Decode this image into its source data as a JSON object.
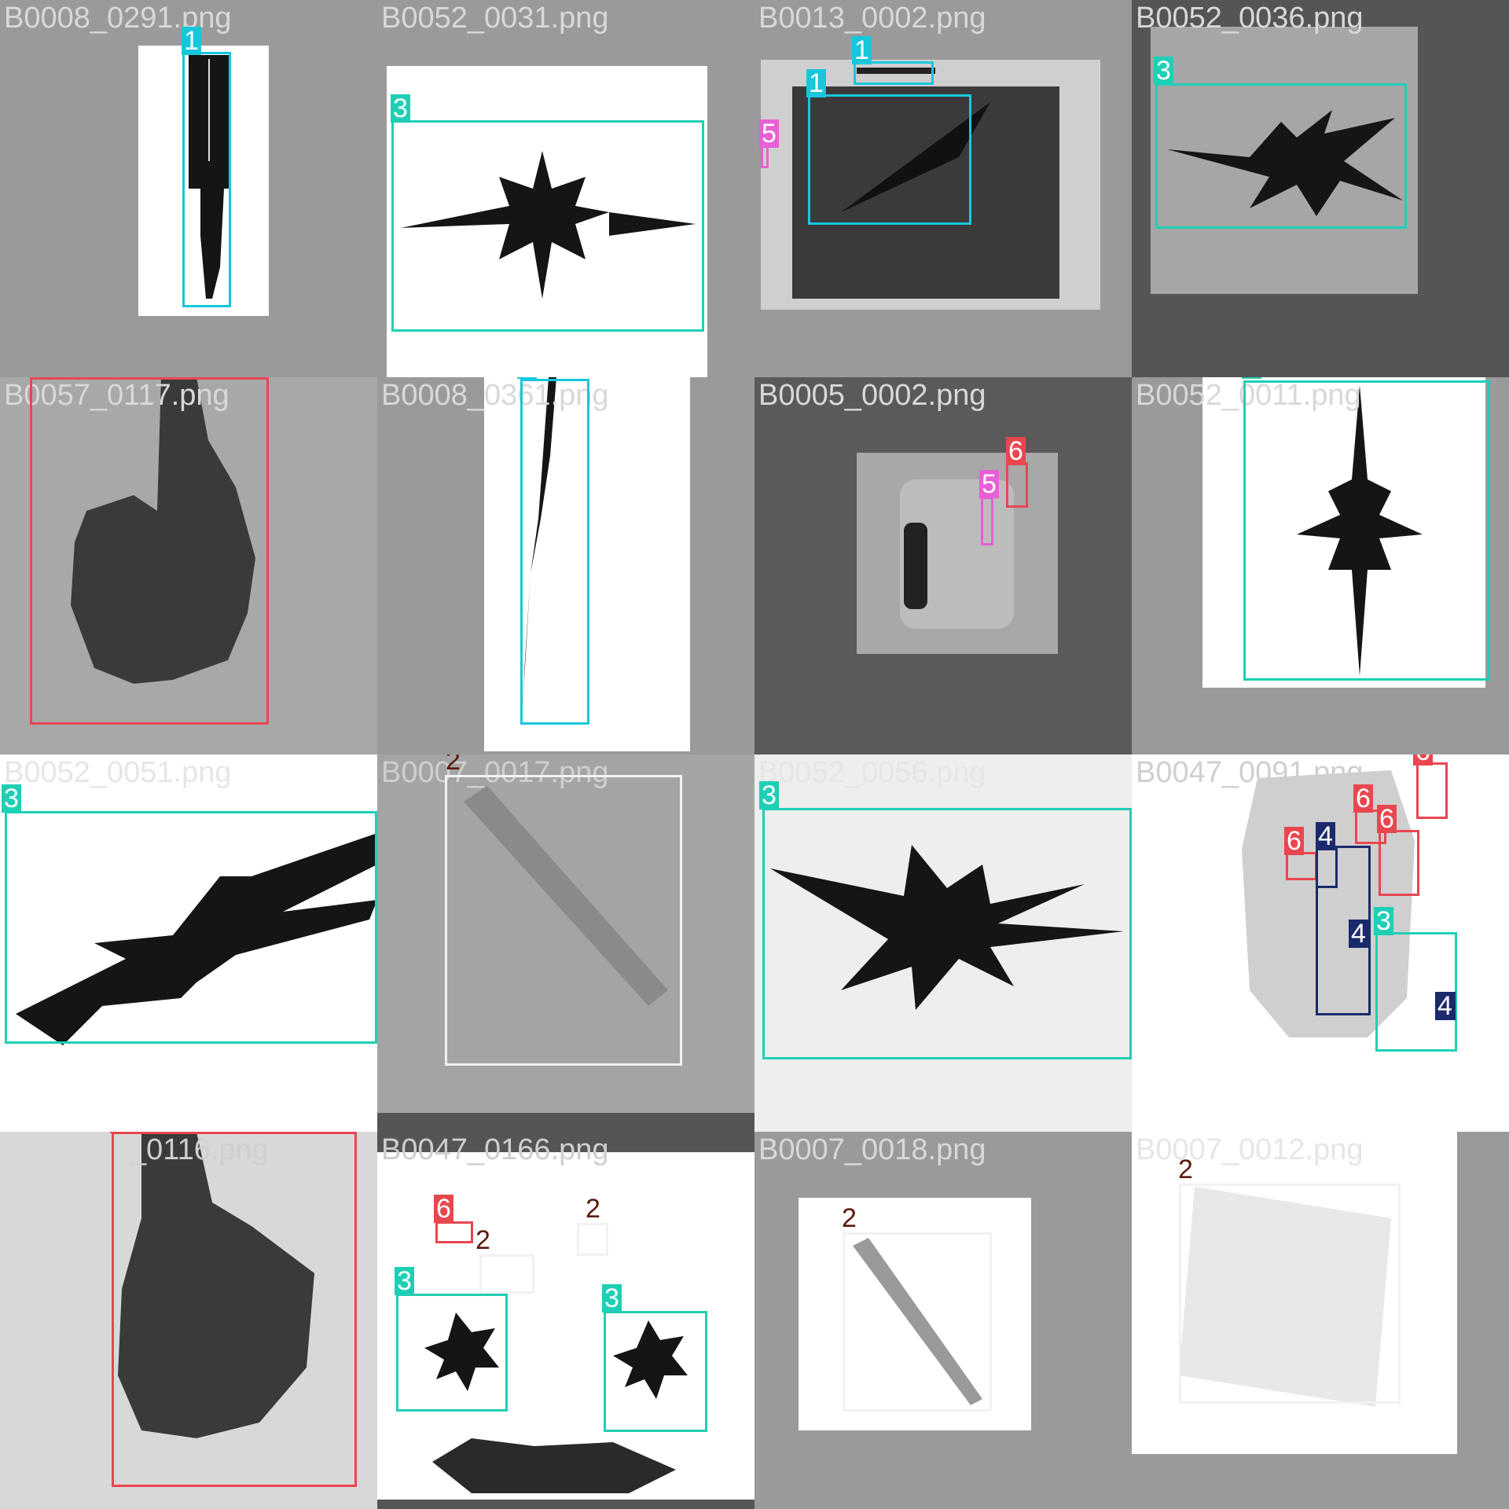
{
  "classes": {
    "1": {
      "color": "#16c7dc"
    },
    "2": {
      "color": "#f2f2f2",
      "label_color": "#5a1a0a"
    },
    "3": {
      "color": "#1fcfb5"
    },
    "4": {
      "color": "#1a2a6b"
    },
    "5": {
      "color": "#e85fd6"
    },
    "6": {
      "color": "#e84750"
    }
  },
  "tiles": [
    {
      "filename": "B0008_0291.png",
      "labels": [
        "1"
      ]
    },
    {
      "filename": "B0052_0031.png",
      "labels": [
        "3"
      ]
    },
    {
      "filename": "B0013_0002.png",
      "labels": [
        "1",
        "1",
        "5"
      ]
    },
    {
      "filename": "B0052_0036.png",
      "labels": [
        "3"
      ]
    },
    {
      "filename": "B0057_0117.png",
      "labels": [
        "6"
      ]
    },
    {
      "filename": "B0008_0361.png",
      "labels": [
        "1"
      ]
    },
    {
      "filename": "B0005_0002.png",
      "labels": [
        "6",
        "5"
      ]
    },
    {
      "filename": "B0052_0011.png",
      "labels": [
        "3"
      ]
    },
    {
      "filename": "B0052_0051.png",
      "labels": [
        "3"
      ]
    },
    {
      "filename": "B0007_0017.png",
      "labels": [
        "2"
      ]
    },
    {
      "filename": "B0052_0056.png",
      "labels": [
        "3"
      ]
    },
    {
      "filename": "B0047_0091.png",
      "labels": [
        "6",
        "6",
        "6",
        "6",
        "4",
        "4",
        "4",
        "3",
        "4"
      ]
    },
    {
      "filename": "_0116.png",
      "labels": [
        "6"
      ]
    },
    {
      "filename": "B0047_0166.png",
      "labels": [
        "6",
        "2",
        "2",
        "3",
        "3"
      ]
    },
    {
      "filename": "B0007_0018.png",
      "labels": [
        "2"
      ]
    },
    {
      "filename": "B0007_0012.png",
      "labels": [
        "2"
      ]
    }
  ]
}
